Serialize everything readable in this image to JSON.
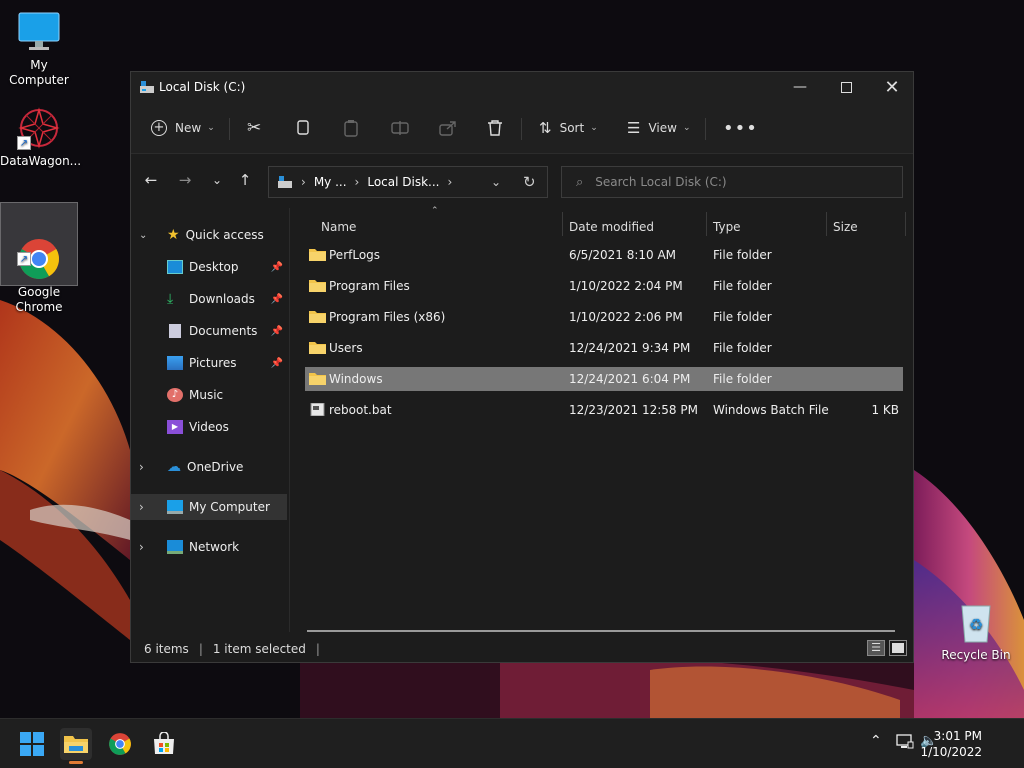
{
  "desktop": {
    "icons": [
      {
        "label": "My Computer"
      },
      {
        "label": "DataWagon..."
      },
      {
        "label": "Google\nChrome"
      },
      {
        "label": "Recycle Bin"
      }
    ]
  },
  "window": {
    "title": "Local Disk (C:)",
    "commands": {
      "new": "New",
      "sort": "Sort",
      "view": "View"
    },
    "address": {
      "crumb1": "My ...",
      "crumb2": "Local Disk..."
    },
    "search": {
      "placeholder": "Search Local Disk (C:)"
    },
    "nav": {
      "quick_access": "Quick access",
      "items": [
        {
          "label": "Desktop"
        },
        {
          "label": "Downloads"
        },
        {
          "label": "Documents"
        },
        {
          "label": "Pictures"
        },
        {
          "label": "Music"
        },
        {
          "label": "Videos"
        }
      ],
      "onedrive": "OneDrive",
      "my_computer": "My Computer",
      "network": "Network"
    },
    "columns": {
      "name": "Name",
      "date": "Date modified",
      "type": "Type",
      "size": "Size"
    },
    "files": [
      {
        "name": "PerfLogs",
        "date": "6/5/2021 8:10 AM",
        "type": "File folder",
        "size": ""
      },
      {
        "name": "Program Files",
        "date": "1/10/2022 2:04 PM",
        "type": "File folder",
        "size": ""
      },
      {
        "name": "Program Files (x86)",
        "date": "1/10/2022 2:06 PM",
        "type": "File folder",
        "size": ""
      },
      {
        "name": "Users",
        "date": "12/24/2021 9:34 PM",
        "type": "File folder",
        "size": ""
      },
      {
        "name": "Windows",
        "date": "12/24/2021 6:04 PM",
        "type": "File folder",
        "size": ""
      },
      {
        "name": "reboot.bat",
        "date": "12/23/2021 12:58 PM",
        "type": "Windows Batch File",
        "size": "1 KB"
      }
    ],
    "status": {
      "count": "6 items",
      "selected": "1 item selected"
    }
  },
  "taskbar": {
    "time": "3:01 PM",
    "date": "1/10/2022"
  }
}
